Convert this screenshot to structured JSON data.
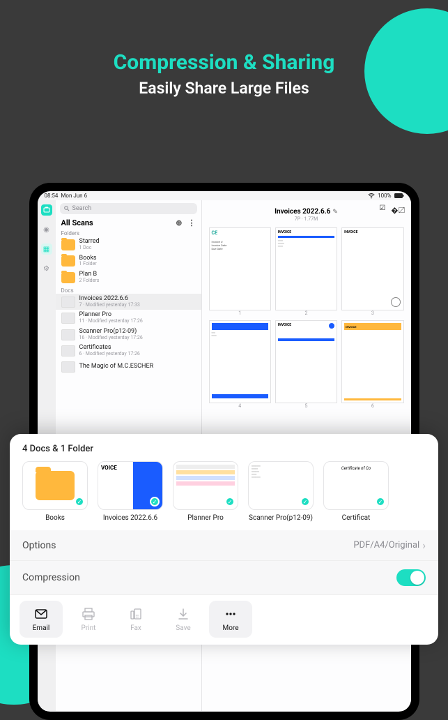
{
  "hero": {
    "title": "Compression & Sharing",
    "subtitle": "Easily Share Large Files"
  },
  "statusbar": {
    "time": "08:54",
    "date": "Mon Jun 6",
    "battery": "100%"
  },
  "search": {
    "placeholder": "Search"
  },
  "list": {
    "title": "All Scans",
    "folders_label": "Folders",
    "docs_label": "Docs",
    "folders": [
      {
        "name": "Starred",
        "sub": "1 Doc"
      },
      {
        "name": "Books",
        "sub": "1 Folder"
      },
      {
        "name": "Plan B",
        "sub": "2 Folders"
      }
    ],
    "docs": [
      {
        "name": "Invoices 2022.6.6",
        "sub": "7 · Modified yesterday 17:33",
        "selected": true
      },
      {
        "name": "Planner Pro",
        "sub": "11 · Modified yesterday 17:26"
      },
      {
        "name": "Scanner Pro(p12-09)",
        "sub": "16 · Modified yesterday 17:26"
      },
      {
        "name": "Certificates",
        "sub": "6 · Modified yesterday 17:26"
      },
      {
        "name": "The Magic of M.C.ESCHER",
        "sub": ""
      }
    ]
  },
  "main": {
    "title": "Invoices 2022.6.6",
    "sub": "7P · 1.77M",
    "pages": [
      "1",
      "2",
      "3",
      "4",
      "5",
      "6"
    ]
  },
  "sheet": {
    "title": "4 Docs & 1 Folder",
    "items": [
      {
        "label": "Books",
        "type": "folder"
      },
      {
        "label": "Invoices 2022.6.6",
        "type": "doc",
        "caption": "VOICE"
      },
      {
        "label": "Planner Pro",
        "type": "doc"
      },
      {
        "label": "Scanner Pro(p12-09)",
        "type": "doc"
      },
      {
        "label": "Certificat",
        "type": "doc",
        "caption": "Certificate of Co"
      }
    ],
    "options_label": "Options",
    "options_value": "PDF/A4/Original",
    "compression_label": "Compression",
    "actions": [
      {
        "label": "Email",
        "icon": "mail",
        "selected": true
      },
      {
        "label": "Print",
        "icon": "print",
        "disabled": true
      },
      {
        "label": "Fax",
        "icon": "fax",
        "disabled": true
      },
      {
        "label": "Save",
        "icon": "save",
        "disabled": true
      },
      {
        "label": "More",
        "icon": "more",
        "selected": true
      }
    ]
  }
}
